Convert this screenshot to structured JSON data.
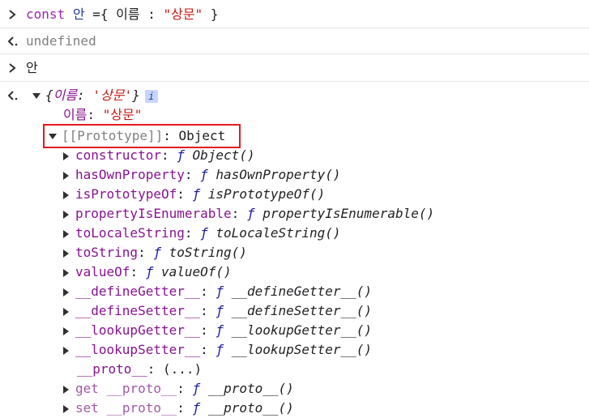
{
  "console": {
    "input1": {
      "keyword": "const",
      "variable": "안",
      "equals": "=",
      "brace_open": "{",
      "key": "이름",
      "colon": ":",
      "value": "\"상문\"",
      "brace_close": "}"
    },
    "result1": "undefined",
    "input2": "안",
    "object_preview": {
      "open": "{",
      "key": "이름",
      "colon": ":",
      "value": "'상문'",
      "close": "}",
      "badge": "i"
    },
    "own_property": {
      "key": "이름",
      "colon": ":",
      "value": "\"상문\""
    },
    "prototype": {
      "label": "[[Prototype]]",
      "colon": ":",
      "value": "Object"
    },
    "members": [
      {
        "name": "constructor",
        "f": "ƒ",
        "sig": "Object()"
      },
      {
        "name": "hasOwnProperty",
        "f": "ƒ",
        "sig": "hasOwnProperty()"
      },
      {
        "name": "isPrototypeOf",
        "f": "ƒ",
        "sig": "isPrototypeOf()"
      },
      {
        "name": "propertyIsEnumerable",
        "f": "ƒ",
        "sig": "propertyIsEnumerable()"
      },
      {
        "name": "toLocaleString",
        "f": "ƒ",
        "sig": "toLocaleString()"
      },
      {
        "name": "toString",
        "f": "ƒ",
        "sig": "toString()"
      },
      {
        "name": "valueOf",
        "f": "ƒ",
        "sig": "valueOf()"
      },
      {
        "name": "__defineGetter__",
        "f": "ƒ",
        "sig": "__defineGetter__()"
      },
      {
        "name": "__defineSetter__",
        "f": "ƒ",
        "sig": "__defineSetter__()"
      },
      {
        "name": "__lookupGetter__",
        "f": "ƒ",
        "sig": "__lookupGetter__()"
      },
      {
        "name": "__lookupSetter__",
        "f": "ƒ",
        "sig": "__lookupSetter__()"
      }
    ],
    "proto_line": {
      "name": "__proto__",
      "colon": ":",
      "value": "(...)"
    },
    "accessors": [
      {
        "prefix": "get",
        "name": "__proto__",
        "f": "ƒ",
        "sig": "__proto__()"
      },
      {
        "prefix": "set",
        "name": "__proto__",
        "f": "ƒ",
        "sig": "__proto__()"
      }
    ]
  }
}
